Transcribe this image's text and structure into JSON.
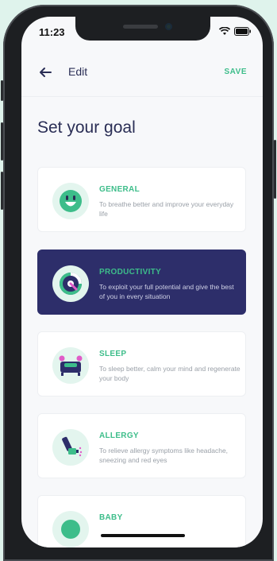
{
  "status_bar": {
    "time": "11:23"
  },
  "header": {
    "back_icon": "arrow-left-icon",
    "title": "Edit",
    "save_label": "SAVE"
  },
  "page": {
    "title": "Set your goal"
  },
  "goals": [
    {
      "title": "GENERAL",
      "description": "To breathe better and improve your everyday life",
      "icon": "smiley-face-icon",
      "selected": false
    },
    {
      "title": "PRODUCTIVITY",
      "description": "To exploit your full potential and give the best of you in every situation",
      "icon": "productivity-gauge-icon",
      "selected": true
    },
    {
      "title": "SLEEP",
      "description": "To sleep better, calm your mind and regenerate your body",
      "icon": "bed-icon",
      "selected": false
    },
    {
      "title": "ALLERGY",
      "description": "To relieve allergy symptoms like headache, sneezing and red eyes",
      "icon": "inhaler-icon",
      "selected": false
    },
    {
      "title": "BABY",
      "description": "",
      "icon": "baby-icon",
      "selected": false
    }
  ],
  "colors": {
    "accent": "#3dbd8a",
    "selected_card": "#2d2e6a",
    "title_text": "#2a2e55",
    "background": "#dff3ec"
  }
}
